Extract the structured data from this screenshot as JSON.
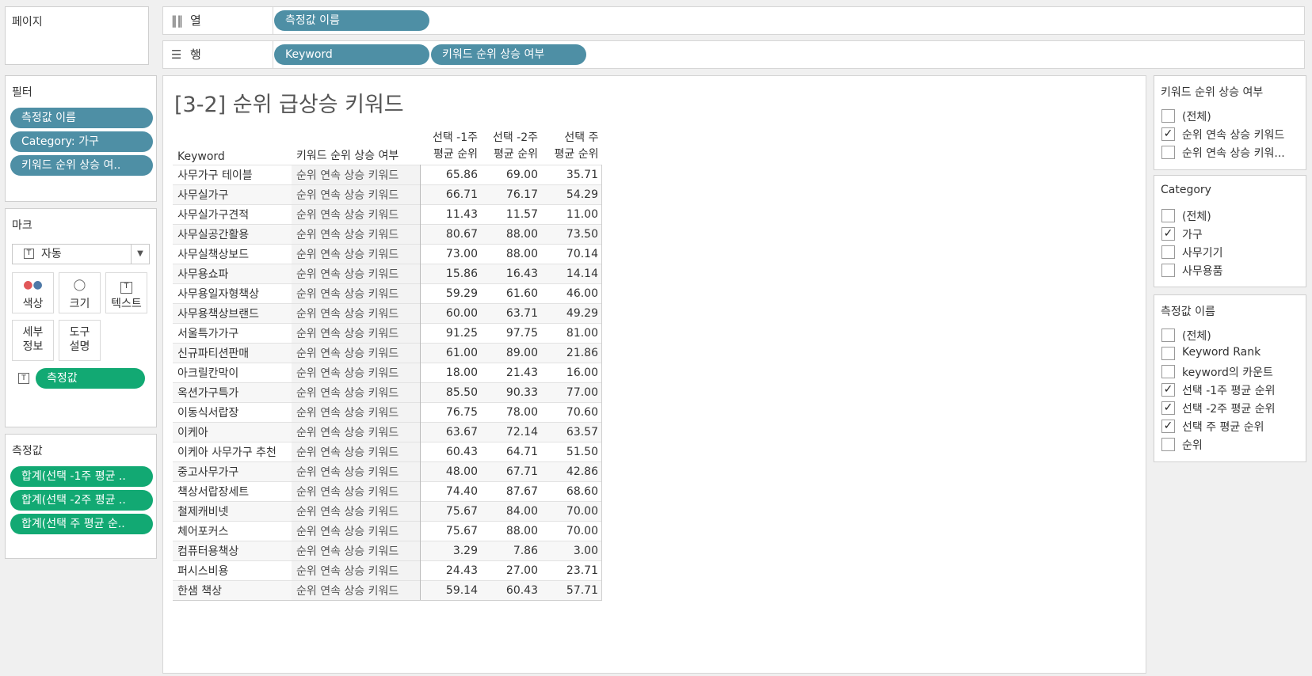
{
  "pages": {
    "title": "페이지"
  },
  "shelves": {
    "columns": {
      "label": "열",
      "pills": [
        "측정값 이름"
      ]
    },
    "rows": {
      "label": "행",
      "pills": [
        "Keyword",
        "키워드 순위 상승 여부"
      ]
    }
  },
  "filters": {
    "title": "필터",
    "pills": [
      "측정값 이름",
      "Category: 가구",
      "키워드 순위 상승 여.."
    ]
  },
  "marks": {
    "title": "마크",
    "type": "자동",
    "cards": [
      {
        "icon": "color-icon",
        "label": "색상"
      },
      {
        "icon": "size-icon",
        "label": "크기"
      },
      {
        "icon": "text-icon",
        "label": "텍스트"
      },
      {
        "icon": "",
        "label": "세부\n정보"
      },
      {
        "icon": "",
        "label": "도구\n설명"
      }
    ],
    "text_pill": "측정값"
  },
  "measure_values": {
    "title": "측정값",
    "pills": [
      "합계(선택 -1주 평균 ..",
      "합계(선택 -2주 평균 ..",
      "합계(선택 주 평균 순.."
    ]
  },
  "view": {
    "title": "[3-2] 순위 급상승 키워드",
    "headers": {
      "keyword": "Keyword",
      "status": "키워드 순위 상승 여부",
      "w1": "선택 -1주\n평균 순위",
      "w2": "선택 -2주\n평균 순위",
      "w0": "선택 주\n평균 순위"
    },
    "rows": [
      {
        "keyword": "사무가구 테이블",
        "status": "순위 연속 상승 키워드",
        "w1": "65.86",
        "w2": "69.00",
        "w0": "35.71"
      },
      {
        "keyword": "사무실가구",
        "status": "순위 연속 상승 키워드",
        "w1": "66.71",
        "w2": "76.17",
        "w0": "54.29"
      },
      {
        "keyword": "사무실가구견적",
        "status": "순위 연속 상승 키워드",
        "w1": "11.43",
        "w2": "11.57",
        "w0": "11.00"
      },
      {
        "keyword": "사무실공간활용",
        "status": "순위 연속 상승 키워드",
        "w1": "80.67",
        "w2": "88.00",
        "w0": "73.50"
      },
      {
        "keyword": "사무실책상보드",
        "status": "순위 연속 상승 키워드",
        "w1": "73.00",
        "w2": "88.00",
        "w0": "70.14"
      },
      {
        "keyword": "사무용쇼파",
        "status": "순위 연속 상승 키워드",
        "w1": "15.86",
        "w2": "16.43",
        "w0": "14.14"
      },
      {
        "keyword": "사무용일자형책상",
        "status": "순위 연속 상승 키워드",
        "w1": "59.29",
        "w2": "61.60",
        "w0": "46.00"
      },
      {
        "keyword": "사무용책상브랜드",
        "status": "순위 연속 상승 키워드",
        "w1": "60.00",
        "w2": "63.71",
        "w0": "49.29"
      },
      {
        "keyword": "서울특가가구",
        "status": "순위 연속 상승 키워드",
        "w1": "91.25",
        "w2": "97.75",
        "w0": "81.00"
      },
      {
        "keyword": "신규파티션판매",
        "status": "순위 연속 상승 키워드",
        "w1": "61.00",
        "w2": "89.00",
        "w0": "21.86"
      },
      {
        "keyword": "아크릴칸막이",
        "status": "순위 연속 상승 키워드",
        "w1": "18.00",
        "w2": "21.43",
        "w0": "16.00"
      },
      {
        "keyword": "옥션가구특가",
        "status": "순위 연속 상승 키워드",
        "w1": "85.50",
        "w2": "90.33",
        "w0": "77.00"
      },
      {
        "keyword": "이동식서랍장",
        "status": "순위 연속 상승 키워드",
        "w1": "76.75",
        "w2": "78.00",
        "w0": "70.60"
      },
      {
        "keyword": "이케아",
        "status": "순위 연속 상승 키워드",
        "w1": "63.67",
        "w2": "72.14",
        "w0": "63.57"
      },
      {
        "keyword": "이케아 사무가구 추천",
        "status": "순위 연속 상승 키워드",
        "w1": "60.43",
        "w2": "64.71",
        "w0": "51.50"
      },
      {
        "keyword": "중고사무가구",
        "status": "순위 연속 상승 키워드",
        "w1": "48.00",
        "w2": "67.71",
        "w0": "42.86"
      },
      {
        "keyword": "책상서랍장세트",
        "status": "순위 연속 상승 키워드",
        "w1": "74.40",
        "w2": "87.67",
        "w0": "68.60"
      },
      {
        "keyword": "철제캐비넷",
        "status": "순위 연속 상승 키워드",
        "w1": "75.67",
        "w2": "84.00",
        "w0": "70.00"
      },
      {
        "keyword": "체어포커스",
        "status": "순위 연속 상승 키워드",
        "w1": "75.67",
        "w2": "88.00",
        "w0": "70.00"
      },
      {
        "keyword": "컴퓨터용책상",
        "status": "순위 연속 상승 키워드",
        "w1": "3.29",
        "w2": "7.86",
        "w0": "3.00"
      },
      {
        "keyword": "퍼시스비용",
        "status": "순위 연속 상승 키워드",
        "w1": "24.43",
        "w2": "27.00",
        "w0": "23.71"
      },
      {
        "keyword": "한샘 책상",
        "status": "순위 연속 상승 키워드",
        "w1": "59.14",
        "w2": "60.43",
        "w0": "57.71"
      }
    ]
  },
  "right_filters": [
    {
      "title": "키워드 순위 상승 여부",
      "options": [
        {
          "label": "(전체)",
          "checked": false
        },
        {
          "label": "순위 연속 상승 키워드",
          "checked": true
        },
        {
          "label": "순위 연속 상승 키워...",
          "checked": false
        }
      ]
    },
    {
      "title": "Category",
      "options": [
        {
          "label": "(전체)",
          "checked": false
        },
        {
          "label": "가구",
          "checked": true
        },
        {
          "label": "사무기기",
          "checked": false
        },
        {
          "label": "사무용품",
          "checked": false
        }
      ]
    },
    {
      "title": "측정값 이름",
      "options": [
        {
          "label": "(전체)",
          "checked": false
        },
        {
          "label": "Keyword Rank",
          "checked": false
        },
        {
          "label": "keyword의 카운트",
          "checked": false
        },
        {
          "label": "선택 -1주 평균 순위",
          "checked": true
        },
        {
          "label": "선택 -2주 평균 순위",
          "checked": true
        },
        {
          "label": "선택 주 평균 순위",
          "checked": true
        },
        {
          "label": "순위",
          "checked": false
        }
      ]
    }
  ],
  "colors": {
    "dimension_pill": "#4e8fa5",
    "measure_pill": "#12a973"
  }
}
